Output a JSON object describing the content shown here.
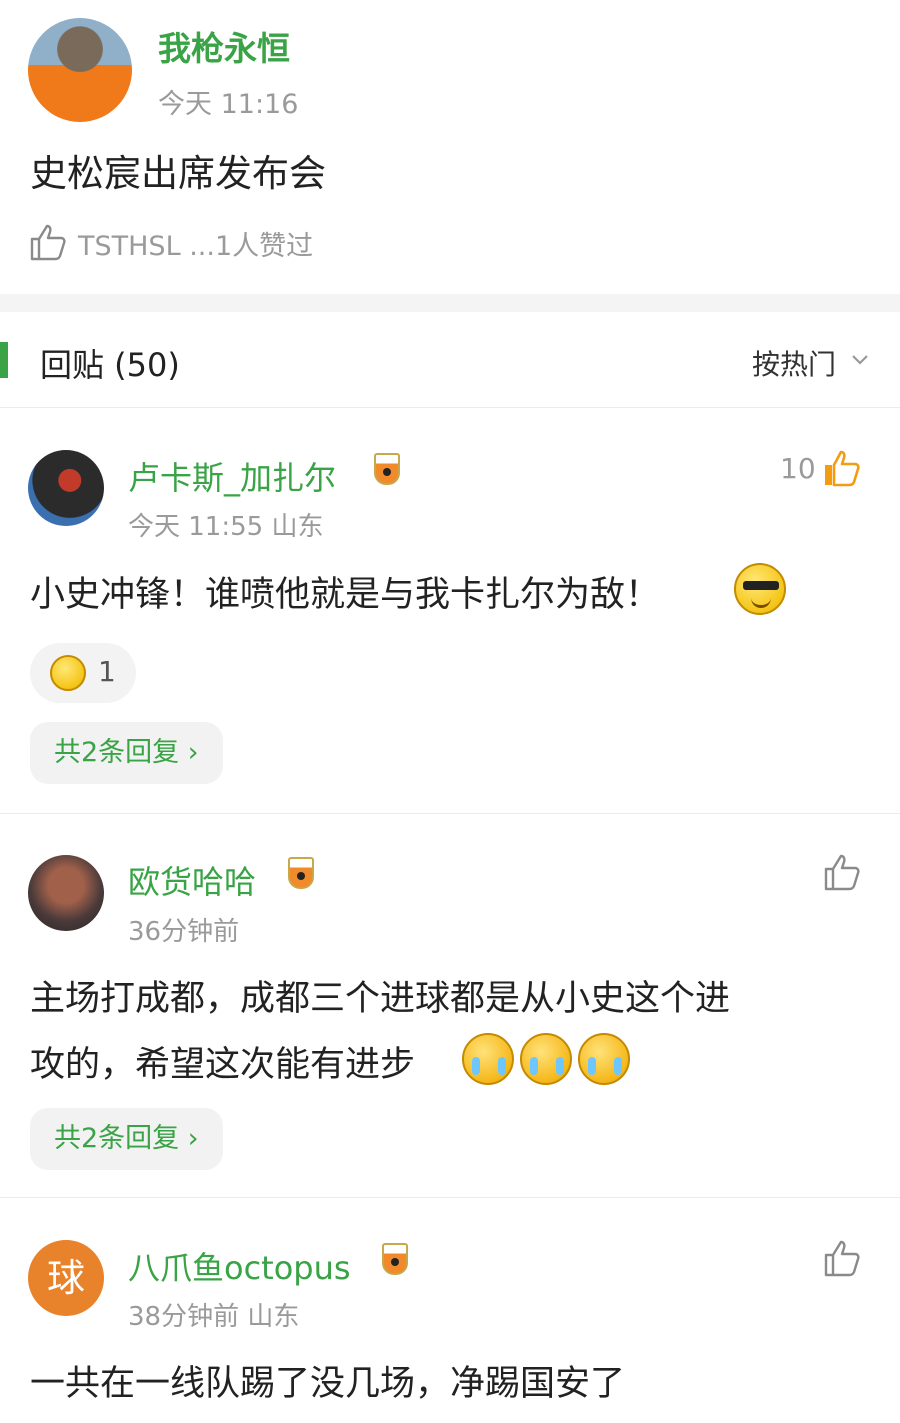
{
  "post": {
    "author": "我枪永恒",
    "time": "今天 11:16",
    "content": "史松宸出席发布会",
    "likes_text": "TSTHSL ...1人赞过"
  },
  "replies_header": {
    "title": "回贴 (50)",
    "sort_label": "按热门"
  },
  "comments": [
    {
      "author": "卢卡斯_加扎尔",
      "meta": "今天 11:55  山东",
      "like_count": "10",
      "content": "小史冲锋！谁喷他就是与我卡扎尔为敌！",
      "reaction_count": "1",
      "replies_label": "共2条回复"
    },
    {
      "author": "欧货哈哈",
      "meta": "36分钟前",
      "content_line1": "主场打成都，成都三个进球都是从小史这个进",
      "content_line2": "攻的，希望这次能有进步",
      "replies_label": "共2条回复"
    },
    {
      "author": "八爪鱼octopus",
      "avatar_char": "球",
      "meta": "38分钟前  山东",
      "content": "一共在一线队踢了没几场，净踢国安了"
    }
  ],
  "colors": {
    "accent_green": "#3aa346",
    "grey_text": "#9a9a9a",
    "orange_like": "#f39c12"
  },
  "icons": [
    "thumb-up-outline-icon",
    "thumb-up-filled-icon",
    "chevron-down-icon",
    "chevron-right-icon",
    "club-badge-icon",
    "smile-emoji-icon",
    "cry-emoji-icon",
    "cool-emoji-icon"
  ]
}
